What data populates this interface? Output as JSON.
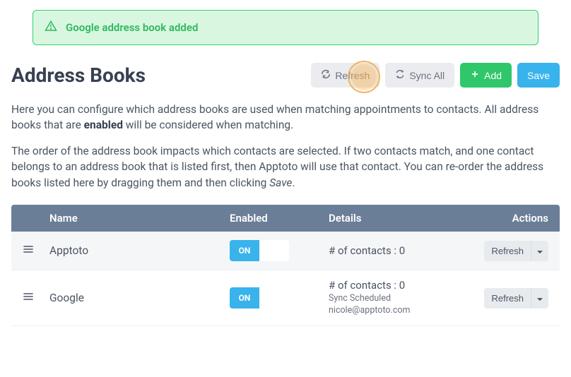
{
  "alert": {
    "message": "Google address book added"
  },
  "page": {
    "title": "Address Books"
  },
  "toolbar": {
    "refresh": "Refresh",
    "sync_all": "Sync All",
    "add": "Add",
    "save": "Save"
  },
  "description": {
    "line1_pre": "Here you can configure which address books are used when matching appointments to contacts. All address books that are ",
    "line1_bold": "enabled",
    "line1_post": " will be considered when matching.",
    "line2_pre": "The order of the address book impacts which contacts are selected. If two contacts match, and one contact belongs to an address book that is listed first, then Apptoto will use that contact. You can re-order the address books listed here by dragging them and then clicking ",
    "line2_em": "Save",
    "line2_post": "."
  },
  "table": {
    "headers": {
      "name": "Name",
      "enabled": "Enabled",
      "details": "Details",
      "actions": "Actions"
    },
    "toggle_on_label": "ON",
    "row_action_label": "Refresh",
    "rows": [
      {
        "name": "Apptoto",
        "details_main": "# of contacts : 0",
        "details_sub1": "",
        "details_sub2": ""
      },
      {
        "name": "Google",
        "details_main": "# of contacts : 0",
        "details_sub1": "Sync Scheduled",
        "details_sub2": "nicole@apptoto.com"
      }
    ]
  }
}
